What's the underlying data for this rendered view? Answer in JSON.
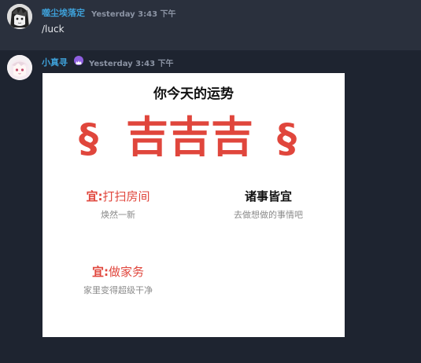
{
  "messages": [
    {
      "username": "噬尘埃落定",
      "timestamp": "Yesterday 3:43 下午",
      "text": "/luck"
    },
    {
      "username": "小真寻",
      "timestamp": "Yesterday 3:43 下午"
    }
  ],
  "fortune_card": {
    "title": "你今天的运势",
    "symbol_left": "§",
    "luck_level": "吉吉吉",
    "symbol_right": "§",
    "items": [
      {
        "label": "宜:",
        "value": "打扫房间",
        "sub": "焕然一新"
      },
      {
        "label": "",
        "value": "诸事皆宜",
        "sub": "去做想做的事情吧"
      },
      {
        "label": "宜:",
        "value": "做家务",
        "sub": "家里变得超级干净"
      }
    ]
  },
  "icons": {
    "user1_avatar": "anime-avatar-bw",
    "user2_avatar": "anime-avatar-pink",
    "bot_badge": "crown-icon"
  },
  "colors": {
    "username": "#3ea0d8",
    "timestamp": "#8b93a3",
    "luck_red": "#e0463c",
    "badge_purple": "#8f5fe0"
  }
}
